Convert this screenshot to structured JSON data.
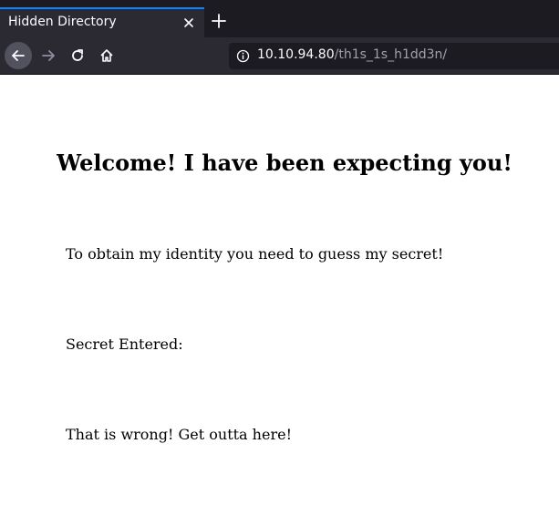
{
  "browser": {
    "tab_title": "Hidden Directory",
    "url_host": "10.10.94.80",
    "url_path": "/th1s_1s_h1dd3n/",
    "colors": {
      "tab_accent": "#0a84ff",
      "chrome_bg": "#1c1b22",
      "toolbar_bg": "#2b2a33"
    },
    "icons": [
      "close-icon",
      "plus-icon",
      "back-arrow-icon",
      "forward-arrow-icon",
      "reload-icon",
      "home-icon",
      "info-icon"
    ]
  },
  "page": {
    "heading": "Welcome! I have been expecting you!",
    "prompt_text": "To obtain my identity you need to guess my secret!",
    "secret_label": "Secret Entered:",
    "result_text": "That is wrong! Get outta here!"
  }
}
